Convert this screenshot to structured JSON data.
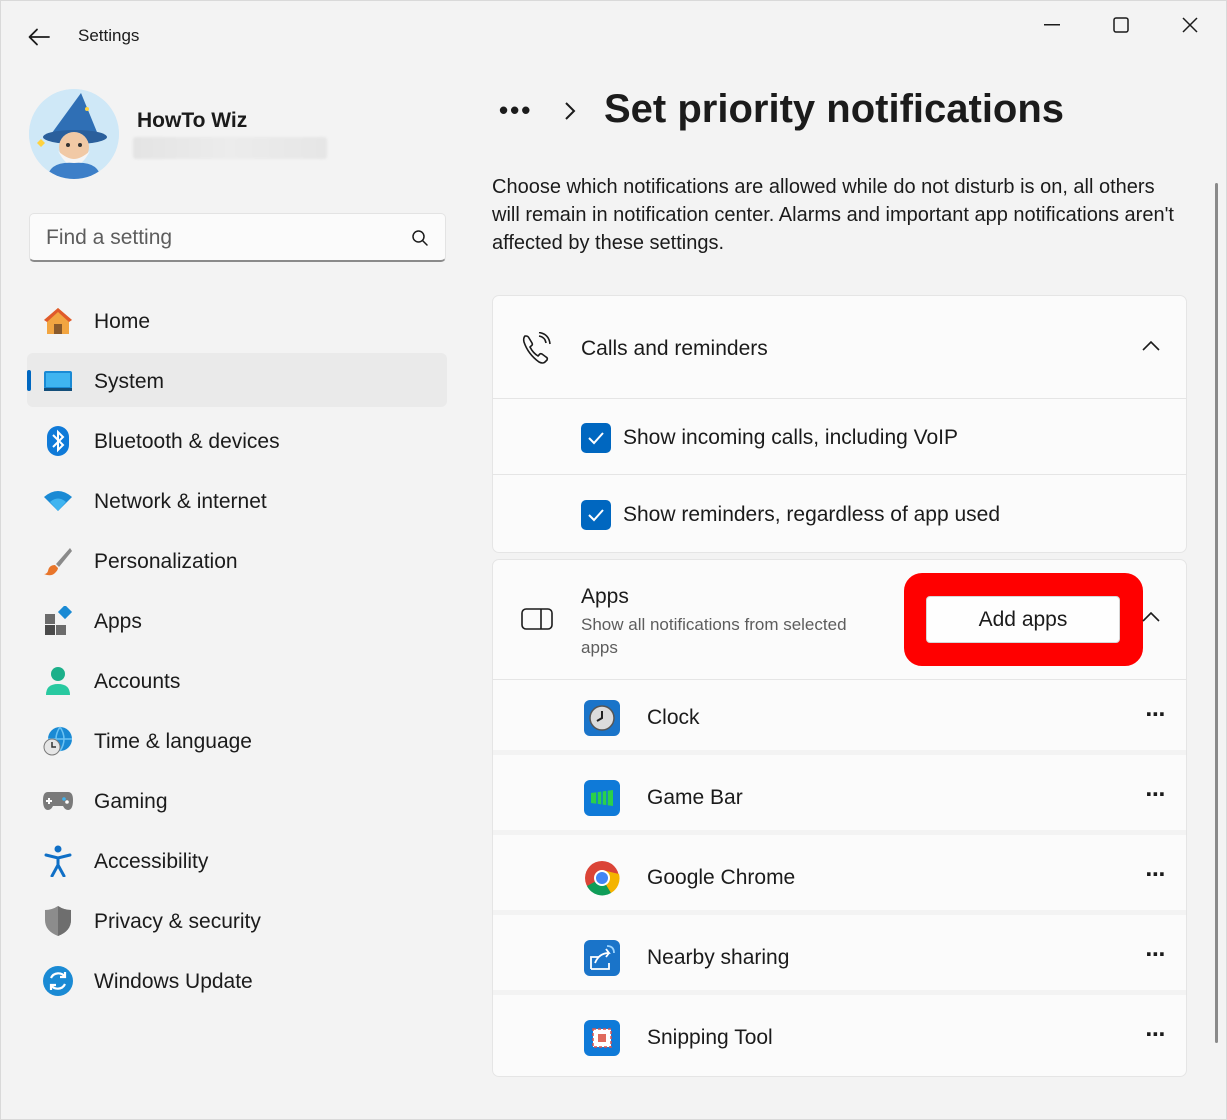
{
  "window": {
    "title": "Settings",
    "back_icon": "arrow-left-icon",
    "controls": [
      "minimize-icon",
      "maximize-icon",
      "close-icon"
    ]
  },
  "profile": {
    "name": "HowTo Wiz",
    "avatar_icon": "wizard-avatar"
  },
  "search": {
    "placeholder": "Find a setting",
    "icon": "search-icon"
  },
  "sidebar": {
    "items": [
      {
        "label": "Home",
        "icon": "home-icon",
        "active": false
      },
      {
        "label": "System",
        "icon": "system-icon",
        "active": true
      },
      {
        "label": "Bluetooth & devices",
        "icon": "bluetooth-icon",
        "active": false
      },
      {
        "label": "Network & internet",
        "icon": "wifi-icon",
        "active": false
      },
      {
        "label": "Personalization",
        "icon": "brush-icon",
        "active": false
      },
      {
        "label": "Apps",
        "icon": "apps-icon",
        "active": false
      },
      {
        "label": "Accounts",
        "icon": "account-icon",
        "active": false
      },
      {
        "label": "Time & language",
        "icon": "globe-clock-icon",
        "active": false
      },
      {
        "label": "Gaming",
        "icon": "gamepad-icon",
        "active": false
      },
      {
        "label": "Accessibility",
        "icon": "accessibility-icon",
        "active": false
      },
      {
        "label": "Privacy & security",
        "icon": "shield-icon",
        "active": false
      },
      {
        "label": "Windows Update",
        "icon": "update-icon",
        "active": false
      }
    ]
  },
  "main": {
    "breadcrumb_more": "•••",
    "title": "Set priority notifications",
    "description": "Choose which notifications are allowed while do not disturb is on, all others will remain in notification center. Alarms and important app notifications aren't affected by these settings.",
    "calls_card": {
      "title": "Calls and reminders",
      "icon": "phone-ringing-icon",
      "options": [
        {
          "label": "Show incoming calls, including VoIP",
          "checked": true
        },
        {
          "label": "Show reminders, regardless of app used",
          "checked": true
        }
      ]
    },
    "apps_card": {
      "title": "Apps",
      "subtitle": "Show all notifications from selected apps",
      "icon": "app-window-icon",
      "add_button": "Add apps",
      "highlight_color": "#ff0000",
      "apps": [
        {
          "name": "Clock",
          "icon": "clock-icon"
        },
        {
          "name": "Game Bar",
          "icon": "game-bar-icon"
        },
        {
          "name": "Google Chrome",
          "icon": "chrome-icon"
        },
        {
          "name": "Nearby sharing",
          "icon": "nearby-sharing-icon"
        },
        {
          "name": "Snipping Tool",
          "icon": "snipping-tool-icon"
        }
      ]
    }
  },
  "colors": {
    "accent": "#0067c0",
    "background": "#f3f3f3",
    "card": "#fbfbfb"
  }
}
